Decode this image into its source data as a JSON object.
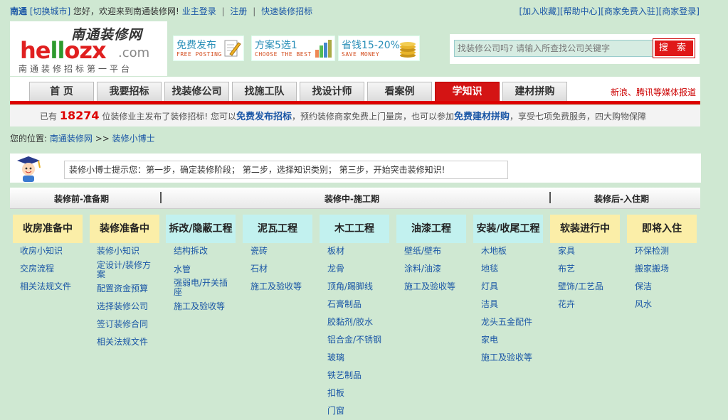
{
  "topbar": {
    "city": "南通",
    "switch_city": "[切换城市]",
    "greeting": "您好，欢迎来到南通装修网!",
    "owner_login": "业主登录",
    "register": "注册",
    "quick_tender": "快速装修招标",
    "add_fav": "[加入收藏]",
    "help": "[帮助中心]",
    "merchant_join": "[商家免费入驻]",
    "merchant_login": "[商家登录]"
  },
  "logo": {
    "cn": "南通装修网",
    "en_a": "he",
    "en_b": "ll",
    "en_c": "ozx",
    "com": ".com",
    "slogan": "南通装修招标第一平台"
  },
  "promos": [
    {
      "cn": "免费发布",
      "en": "FREE POSTING",
      "icon": "pencil-paper-icon"
    },
    {
      "cn": "方案5选1",
      "en": "CHOOSE THE BEST",
      "icon": "bar-chart-icon"
    },
    {
      "cn": "省钱15-20%",
      "en": "SAVE MONEY",
      "icon": "coins-icon"
    }
  ],
  "search": {
    "placeholder": "找装修公司吗? 请输入所查找公司关键字",
    "button": "搜 索"
  },
  "nav": {
    "tabs": [
      "首 页",
      "我要招标",
      "找装修公司",
      "找施工队",
      "找设计师",
      "看案例",
      "学知识",
      "建材拼购"
    ],
    "active_index": 6,
    "media": "新浪、腾讯等媒体报道"
  },
  "notice": {
    "a": "已有",
    "count": "18274",
    "b": "位装修业主发布了装修招标!  您可以",
    "link1": "免费发布招标",
    "c": "，预约装修商家免费上门量房，也可以参加",
    "link2": "免费建材拼购",
    "d": "，享受七项免费服务，四大购物保障"
  },
  "breadcrumb": {
    "label": "您的位置:",
    "home": "南通装修网",
    "sep": ">>",
    "current": "装修小博士"
  },
  "tip": "装修小博士提示您：第一步，确定装修阶段；      第二步，选择知识类别；      第三步，开始突击装修知识!",
  "phases": [
    "装修前-准备期",
    "装修中-施工期",
    "装修后-入住期"
  ],
  "categories": [
    {
      "title": "收房准备中",
      "items": [
        "收房小知识",
        "交房流程",
        "相关法规文件"
      ]
    },
    {
      "title": "装修准备中",
      "items": [
        "装修小知识",
        "定设计/装修方案",
        "配置资金预算",
        "选择装修公司",
        "签订装修合同",
        "相关法规文件"
      ]
    },
    {
      "title": "拆改/隐蔽工程",
      "items": [
        "结构拆改",
        "水管",
        "强弱电/开关插座",
        "施工及验收等"
      ]
    },
    {
      "title": "泥瓦工程",
      "items": [
        "瓷砖",
        "石材",
        "施工及验收等"
      ]
    },
    {
      "title": "木工工程",
      "items": [
        "板材",
        "龙骨",
        "顶角/踢脚线",
        "石膏制品",
        "胶黏剂/胶水",
        "铝合金/不锈钢",
        "玻璃",
        "铁艺制品",
        "扣板",
        "门窗"
      ]
    },
    {
      "title": "油漆工程",
      "items": [
        "壁纸/壁布",
        "涂料/油漆",
        "施工及验收等"
      ]
    },
    {
      "title": "安装/收尾工程",
      "items": [
        "木地板",
        "地毯",
        "灯具",
        "洁具",
        "龙头五金配件",
        "家电",
        "施工及验收等"
      ]
    },
    {
      "title": "软装进行中",
      "items": [
        "家具",
        "布艺",
        "壁饰/工艺品",
        "花卉"
      ]
    },
    {
      "title": "即将入住",
      "items": [
        "环保检测",
        "搬家搬场",
        "保洁",
        "风水"
      ]
    }
  ]
}
